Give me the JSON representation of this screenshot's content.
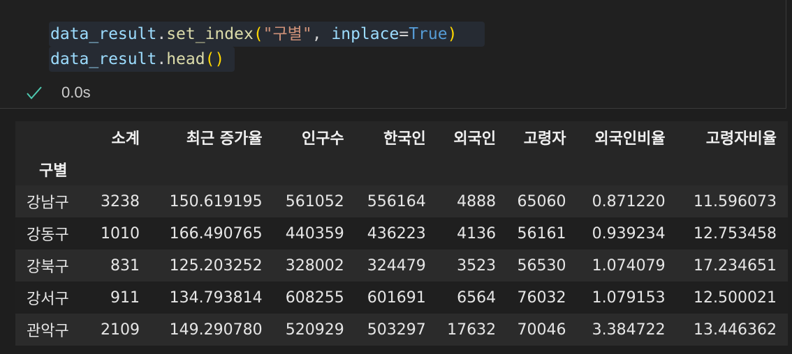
{
  "code_cell": {
    "line1": {
      "obj": "data_result",
      "dot": ".",
      "method": "set_index",
      "open": "(",
      "arg_str": "\"구별\"",
      "comma": ", ",
      "kwarg": "inplace",
      "eq": "=",
      "kwval": "True",
      "close": ")"
    },
    "line2": {
      "obj": "data_result",
      "dot": ".",
      "method": "head",
      "parens": "()"
    }
  },
  "status": {
    "icon": "check-icon",
    "time": "0.0s",
    "color": "#4ec9b0"
  },
  "dataframe": {
    "index_name": "구별",
    "columns": [
      "소계",
      "최근 증가율",
      "인구수",
      "한국인",
      "외국인",
      "고령자",
      "외국인비율",
      "고령자비율"
    ],
    "rows": [
      {
        "index": "강남구",
        "values": [
          "3238",
          "150.619195",
          "561052",
          "556164",
          "4888",
          "65060",
          "0.871220",
          "11.596073"
        ]
      },
      {
        "index": "강동구",
        "values": [
          "1010",
          "166.490765",
          "440359",
          "436223",
          "4136",
          "56161",
          "0.939234",
          "12.753458"
        ]
      },
      {
        "index": "강북구",
        "values": [
          "831",
          "125.203252",
          "328002",
          "324479",
          "3523",
          "56530",
          "1.074079",
          "17.234651"
        ]
      },
      {
        "index": "강서구",
        "values": [
          "911",
          "134.793814",
          "608255",
          "601691",
          "6564",
          "76032",
          "1.079153",
          "12.500021"
        ]
      },
      {
        "index": "관악구",
        "values": [
          "2109",
          "149.290780",
          "520929",
          "503297",
          "17632",
          "70046",
          "3.384722",
          "13.446362"
        ]
      }
    ]
  }
}
